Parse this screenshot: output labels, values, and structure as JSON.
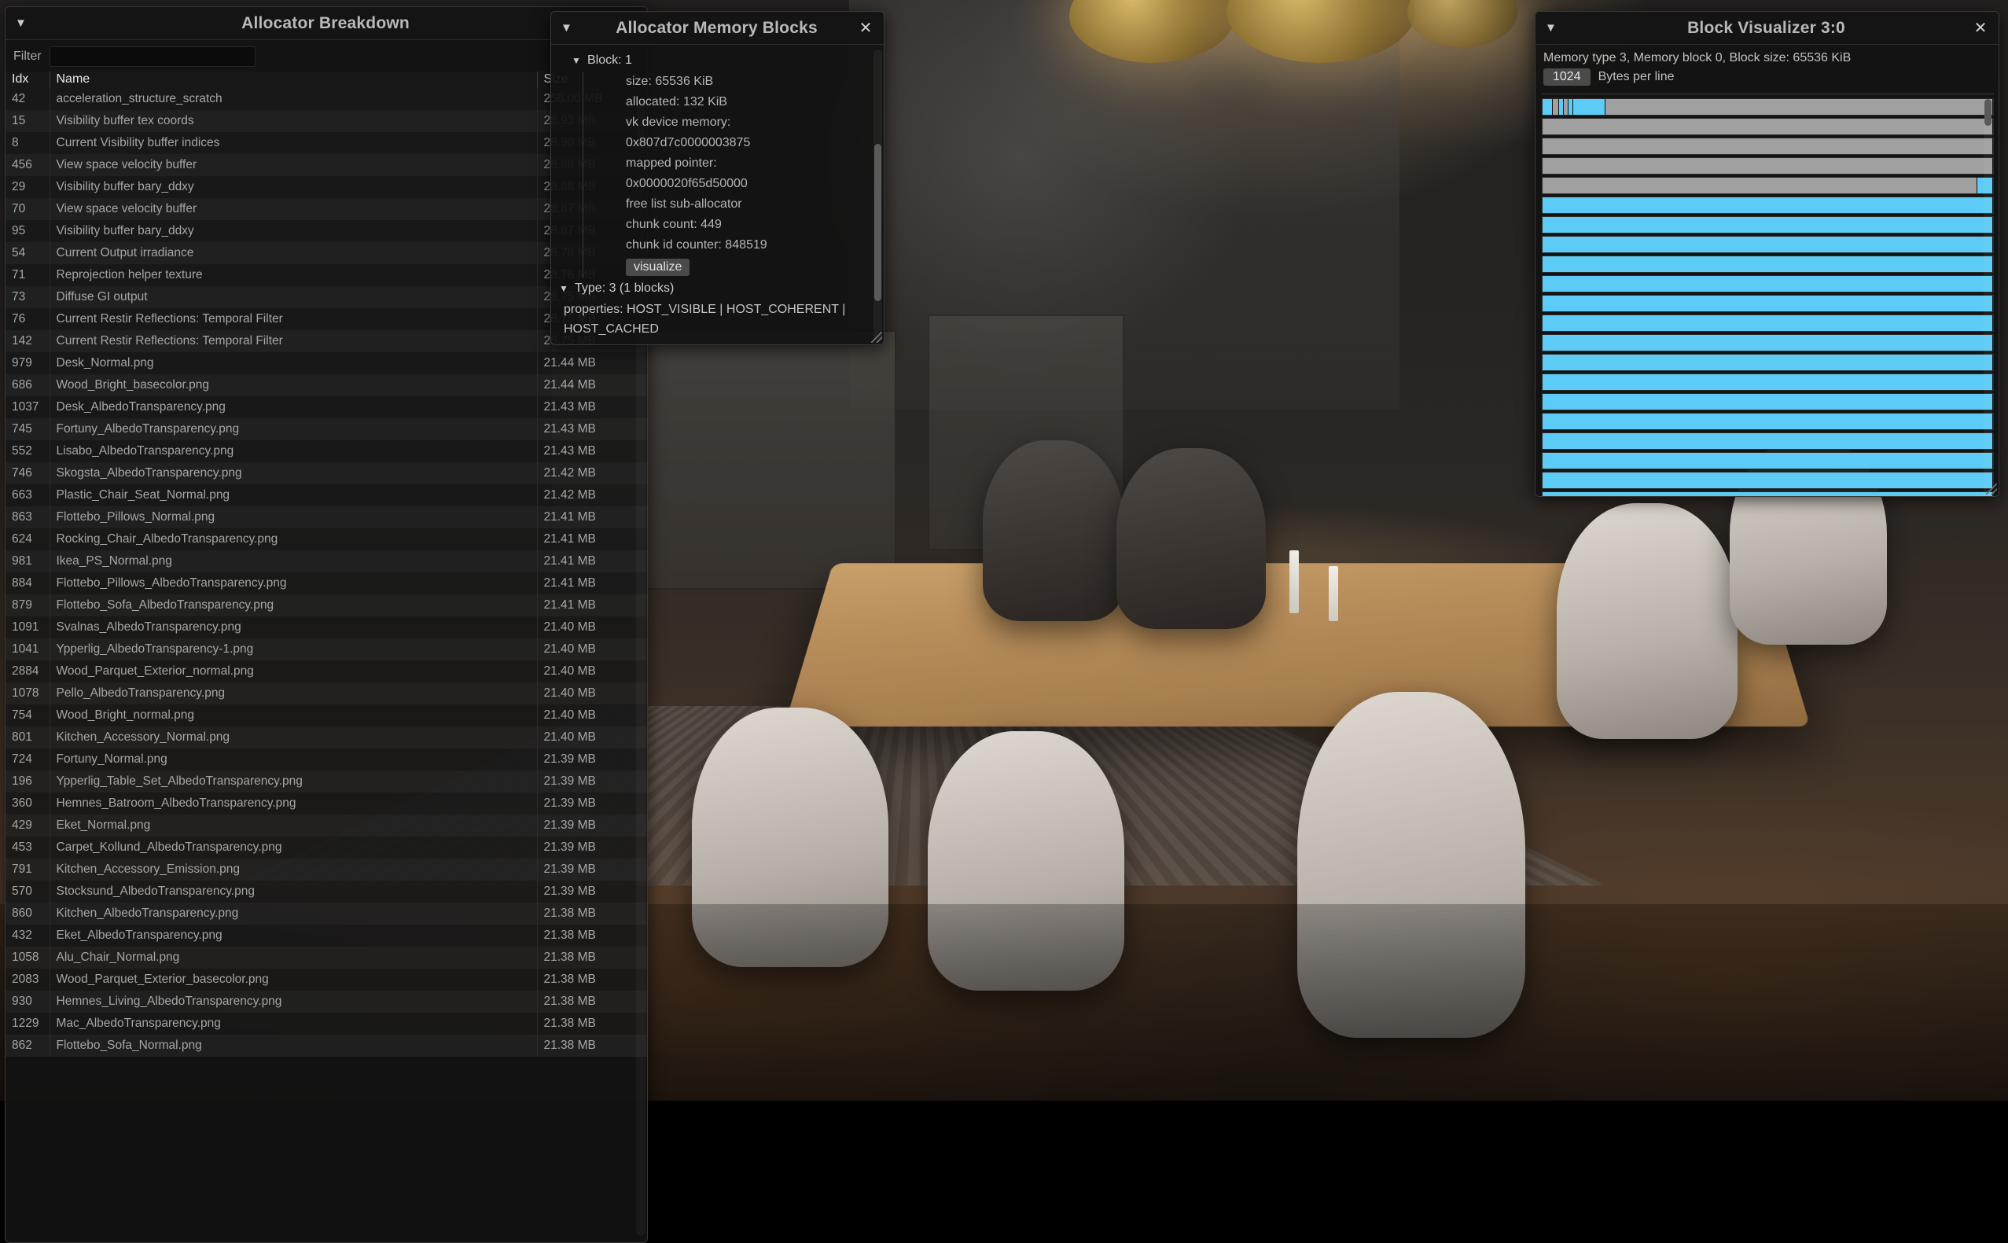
{
  "colors": {
    "allocated": "#5ccbf5",
    "free": "#a0a0a0",
    "window_bg": "#121212",
    "title_bg": "#141414",
    "text": "#c8c8c8"
  },
  "breakdown": {
    "title": "Allocator Breakdown",
    "collapse_icon": "▼",
    "close_icon": "✕",
    "filter_label": "Filter",
    "filter_value": "",
    "filter_placeholder": "",
    "columns": [
      "Idx",
      "Name",
      "Size"
    ],
    "rows": [
      [
        "42",
        "acceleration_structure_scratch",
        "256.00 MB"
      ],
      [
        "15",
        "Visibility buffer tex coords",
        "28.93 MB"
      ],
      [
        "8",
        "Current Visibility buffer indices",
        "28.90 MB"
      ],
      [
        "456",
        "View space velocity buffer",
        "28.88 MB"
      ],
      [
        "29",
        "Visibility buffer bary_ddxy",
        "28.88 MB"
      ],
      [
        "70",
        "View space velocity buffer",
        "28.87 MB"
      ],
      [
        "95",
        "Visibility buffer bary_ddxy",
        "28.87 MB"
      ],
      [
        "54",
        "Current Output irradiance",
        "28.78 MB"
      ],
      [
        "71",
        "Reprojection helper texture",
        "28.76 MB"
      ],
      [
        "73",
        "Diffuse GI output",
        "28.75 MB"
      ],
      [
        "76",
        "Current Restir Reflections: Temporal Filter",
        "28.75 MB"
      ],
      [
        "142",
        "Current Restir Reflections: Temporal Filter",
        "28.75 MB"
      ],
      [
        "979",
        "Desk_Normal.png",
        "21.44 MB"
      ],
      [
        "686",
        "Wood_Bright_basecolor.png",
        "21.44 MB"
      ],
      [
        "1037",
        "Desk_AlbedoTransparency.png",
        "21.43 MB"
      ],
      [
        "745",
        "Fortuny_AlbedoTransparency.png",
        "21.43 MB"
      ],
      [
        "552",
        "Lisabo_AlbedoTransparency.png",
        "21.43 MB"
      ],
      [
        "746",
        "Skogsta_AlbedoTransparency.png",
        "21.42 MB"
      ],
      [
        "663",
        "Plastic_Chair_Seat_Normal.png",
        "21.42 MB"
      ],
      [
        "863",
        "Flottebo_Pillows_Normal.png",
        "21.41 MB"
      ],
      [
        "624",
        "Rocking_Chair_AlbedoTransparency.png",
        "21.41 MB"
      ],
      [
        "981",
        "Ikea_PS_Normal.png",
        "21.41 MB"
      ],
      [
        "884",
        "Flottebo_Pillows_AlbedoTransparency.png",
        "21.41 MB"
      ],
      [
        "879",
        "Flottebo_Sofa_AlbedoTransparency.png",
        "21.41 MB"
      ],
      [
        "1091",
        "Svalnas_AlbedoTransparency.png",
        "21.40 MB"
      ],
      [
        "1041",
        "Ypperlig_AlbedoTransparency-1.png",
        "21.40 MB"
      ],
      [
        "2884",
        "Wood_Parquet_Exterior_normal.png",
        "21.40 MB"
      ],
      [
        "1078",
        "Pello_AlbedoTransparency.png",
        "21.40 MB"
      ],
      [
        "754",
        "Wood_Bright_normal.png",
        "21.40 MB"
      ],
      [
        "801",
        "Kitchen_Accessory_Normal.png",
        "21.40 MB"
      ],
      [
        "724",
        "Fortuny_Normal.png",
        "21.39 MB"
      ],
      [
        "196",
        "Ypperlig_Table_Set_AlbedoTransparency.png",
        "21.39 MB"
      ],
      [
        "360",
        "Hemnes_Batroom_AlbedoTransparency.png",
        "21.39 MB"
      ],
      [
        "429",
        "Eket_Normal.png",
        "21.39 MB"
      ],
      [
        "453",
        "Carpet_Kollund_AlbedoTransparency.png",
        "21.39 MB"
      ],
      [
        "791",
        "Kitchen_Accessory_Emission.png",
        "21.39 MB"
      ],
      [
        "570",
        "Stocksund_AlbedoTransparency.png",
        "21.39 MB"
      ],
      [
        "860",
        "Kitchen_AlbedoTransparency.png",
        "21.38 MB"
      ],
      [
        "432",
        "Eket_AlbedoTransparency.png",
        "21.38 MB"
      ],
      [
        "1058",
        "Alu_Chair_Normal.png",
        "21.38 MB"
      ],
      [
        "2083",
        "Wood_Parquet_Exterior_basecolor.png",
        "21.38 MB"
      ],
      [
        "930",
        "Hemnes_Living_AlbedoTransparency.png",
        "21.38 MB"
      ],
      [
        "1229",
        "Mac_AlbedoTransparency.png",
        "21.38 MB"
      ],
      [
        "862",
        "Flottebo_Sofa_Normal.png",
        "21.38 MB"
      ]
    ]
  },
  "memory_blocks": {
    "title": "Allocator Memory Blocks",
    "collapse_icon": "▼",
    "close_icon": "✕",
    "block_node": "Block: 1",
    "fields": [
      "size: 65536 KiB",
      "allocated: 132 KiB",
      "vk device memory:",
      "0x807d7c0000003875",
      "mapped pointer:",
      "0x0000020f65d50000",
      "free list sub-allocator",
      "chunk count: 449",
      "chunk id counter: 848519"
    ],
    "visualize_label": "visualize",
    "type_node": "Type: 3 (1 blocks)",
    "properties": "properties: HOST_VISIBLE | HOST_COHERENT | HOST_CACHED"
  },
  "visualizer": {
    "title": "Block Visualizer 3:0",
    "collapse_icon": "▼",
    "close_icon": "✕",
    "info": "Memory type 3, Memory block 0, Block size: 65536 KiB",
    "bytes_per_line_value": "1024",
    "bytes_per_line_label": "Bytes per line",
    "rows": [
      [
        {
          "w": 2.2,
          "s": "allocated"
        },
        {
          "w": 1.4,
          "s": "free"
        },
        {
          "w": 1.2,
          "s": "allocated"
        },
        {
          "w": 0.9,
          "s": "free"
        },
        {
          "w": 1.1,
          "s": "allocated"
        },
        {
          "w": 7.2,
          "s": "allocated"
        },
        {
          "w": 86.0,
          "s": "free"
        }
      ],
      [
        {
          "w": 100,
          "s": "free"
        }
      ],
      [
        {
          "w": 100,
          "s": "free"
        }
      ],
      [
        {
          "w": 100,
          "s": "free"
        }
      ],
      [
        {
          "w": 96.5,
          "s": "free"
        },
        {
          "w": 3.5,
          "s": "allocated"
        }
      ],
      [
        {
          "w": 100,
          "s": "allocated"
        }
      ],
      [
        {
          "w": 100,
          "s": "allocated"
        }
      ],
      [
        {
          "w": 100,
          "s": "allocated"
        }
      ],
      [
        {
          "w": 100,
          "s": "allocated"
        }
      ],
      [
        {
          "w": 100,
          "s": "allocated"
        }
      ],
      [
        {
          "w": 100,
          "s": "allocated"
        }
      ],
      [
        {
          "w": 100,
          "s": "allocated"
        }
      ],
      [
        {
          "w": 100,
          "s": "allocated"
        }
      ],
      [
        {
          "w": 100,
          "s": "allocated"
        }
      ],
      [
        {
          "w": 100,
          "s": "allocated"
        }
      ],
      [
        {
          "w": 100,
          "s": "allocated"
        }
      ],
      [
        {
          "w": 100,
          "s": "allocated"
        }
      ],
      [
        {
          "w": 100,
          "s": "allocated"
        }
      ],
      [
        {
          "w": 100,
          "s": "allocated"
        }
      ],
      [
        {
          "w": 100,
          "s": "allocated"
        }
      ],
      [
        {
          "w": 100,
          "s": "allocated"
        }
      ]
    ]
  }
}
